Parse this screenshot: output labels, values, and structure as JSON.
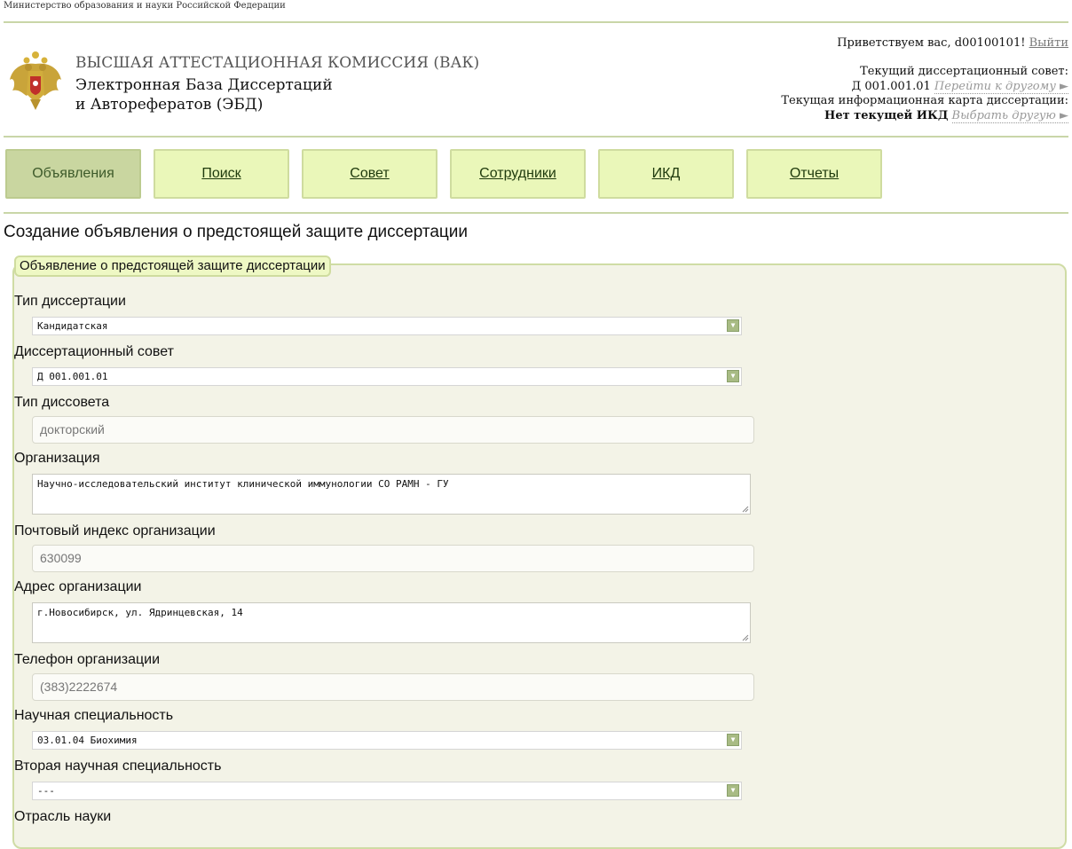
{
  "header": {
    "ministry": "Министерство образования и науки Российской Федерации",
    "title_line1": "ВЫСШАЯ АТТЕСТАЦИОННАЯ КОМИССИЯ (ВАК)",
    "title_line2": "Электронная База Диссертаций",
    "title_line3": "и Авторефератов (ЭБД)",
    "greeting": "Приветствуем вас, d00100101!",
    "logout": "Выйти",
    "current_council_label": "Текущий диссертационный совет:",
    "current_council_value": "Д 001.001.01",
    "switch_council": "Перейти к другому ►",
    "current_card_label": "Текущая информационная карта диссертации:",
    "current_card_value": "Нет текущей ИКД",
    "choose_card": "Выбрать другую ►"
  },
  "nav": {
    "tabs": [
      {
        "label": "Объявления",
        "active": true
      },
      {
        "label": "Поиск"
      },
      {
        "label": "Совет"
      },
      {
        "label": "Сотрудники"
      },
      {
        "label": "ИКД"
      },
      {
        "label": "Отчеты"
      }
    ]
  },
  "page_title": "Создание объявления о предстоящей защите диссертации",
  "form": {
    "legend": "Объявление о предстоящей защите диссертации",
    "fields": {
      "dissertation_type": {
        "label": "Тип диссертации",
        "value": "Кандидатская"
      },
      "council": {
        "label": "Диссертационный совет",
        "value": "Д 001.001.01"
      },
      "council_type": {
        "label": "Тип диссовета",
        "value": "докторский"
      },
      "organization": {
        "label": "Организация",
        "value": "Научно-исследовательский институт клинической иммунологии СО РАМН - ГУ"
      },
      "postal_code": {
        "label": "Почтовый индекс организации",
        "value": "630099"
      },
      "address": {
        "label": "Адрес организации",
        "value": "г.Новосибирск, ул. Ядринцевская, 14"
      },
      "phone": {
        "label": "Телефон организации",
        "value": "(383)2222674"
      },
      "specialty": {
        "label": "Научная специальность",
        "value": "03.01.04 Биохимия"
      },
      "specialty2": {
        "label": "Вторая научная специальность",
        "value": "---"
      },
      "science_branch": {
        "label": "Отрасль науки"
      }
    }
  },
  "colors": {
    "nav_bg": "#eaf7b9",
    "nav_active_bg": "#c9d6a0",
    "panel_bg": "#f3f3e7",
    "border_accent": "#cfdca5"
  },
  "icons": {
    "emblem": "russian-coat-of-arms",
    "dropdown": "chevron-down-icon"
  }
}
